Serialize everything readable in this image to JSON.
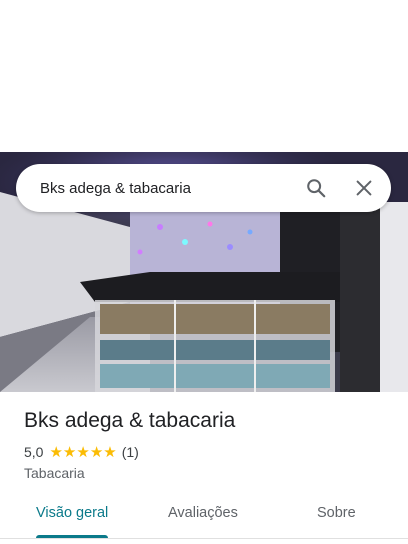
{
  "search": {
    "query": "Bks adega & tabacaria",
    "search_icon": "search-icon",
    "close_icon": "close-icon"
  },
  "place": {
    "name": "Bks adega & tabacaria",
    "rating": "5,0",
    "stars": 5,
    "review_count": "(1)",
    "category": "Tabacaria"
  },
  "tabs": [
    {
      "label": "Visão geral",
      "active": true
    },
    {
      "label": "Avaliações",
      "active": false
    },
    {
      "label": "Sobre",
      "active": false
    }
  ],
  "colors": {
    "accent": "#0b7a8a",
    "star": "#fbbc04"
  }
}
